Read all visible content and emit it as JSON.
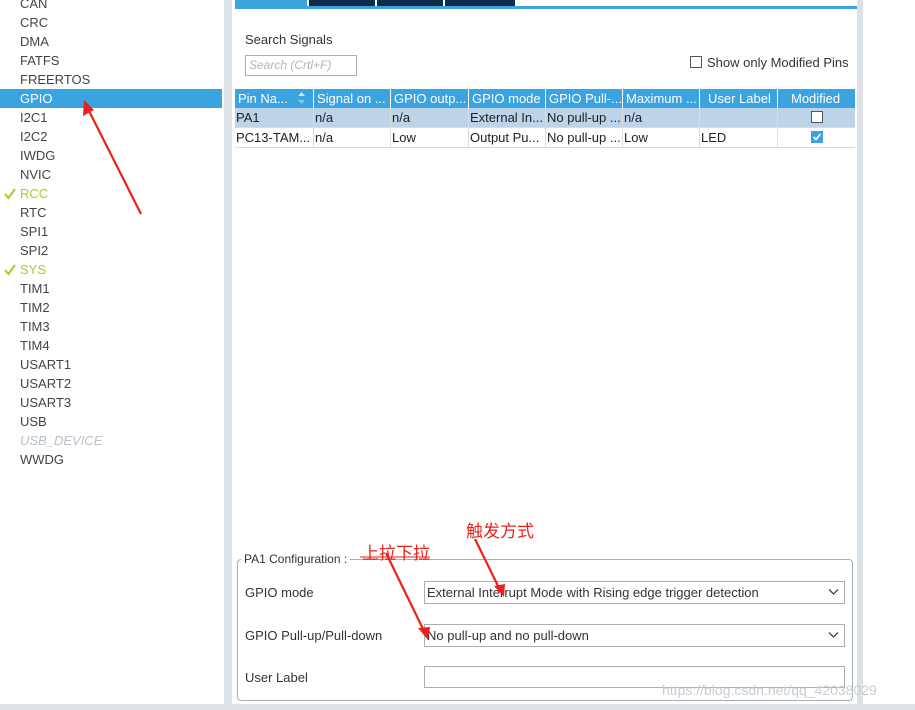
{
  "sidebar": {
    "items": [
      {
        "label": "CAN",
        "state": "normal"
      },
      {
        "label": "CRC",
        "state": "normal"
      },
      {
        "label": "DMA",
        "state": "normal"
      },
      {
        "label": "FATFS",
        "state": "normal"
      },
      {
        "label": "FREERTOS",
        "state": "normal"
      },
      {
        "label": "GPIO",
        "state": "selected"
      },
      {
        "label": "I2C1",
        "state": "normal"
      },
      {
        "label": "I2C2",
        "state": "normal"
      },
      {
        "label": "IWDG",
        "state": "normal"
      },
      {
        "label": "NVIC",
        "state": "normal"
      },
      {
        "label": "RCC",
        "state": "checked"
      },
      {
        "label": "RTC",
        "state": "normal"
      },
      {
        "label": "SPI1",
        "state": "normal"
      },
      {
        "label": "SPI2",
        "state": "normal"
      },
      {
        "label": "SYS",
        "state": "checked"
      },
      {
        "label": "TIM1",
        "state": "normal"
      },
      {
        "label": "TIM2",
        "state": "normal"
      },
      {
        "label": "TIM3",
        "state": "normal"
      },
      {
        "label": "TIM4",
        "state": "normal"
      },
      {
        "label": "USART1",
        "state": "normal"
      },
      {
        "label": "USART2",
        "state": "normal"
      },
      {
        "label": "USART3",
        "state": "normal"
      },
      {
        "label": "USB",
        "state": "normal"
      },
      {
        "label": "USB_DEVICE",
        "state": "disabled"
      },
      {
        "label": "WWDG",
        "state": "normal"
      }
    ]
  },
  "search": {
    "label": "Search Signals",
    "placeholder": "Search (Crtl+F)",
    "show_modified_label": "Show only Modified Pins",
    "show_modified_checked": false
  },
  "table": {
    "columns": [
      "Pin Na...",
      "Signal on ...",
      "GPIO outp...",
      "GPIO mode",
      "GPIO Pull-...",
      "Maximum ...",
      "User Label",
      "Modified"
    ],
    "rows": [
      {
        "cells": [
          "PA1",
          "n/a",
          "n/a",
          "External In...",
          "No pull-up ...",
          "n/a",
          ""
        ],
        "modified": false,
        "selected": true
      },
      {
        "cells": [
          "PC13-TAM...",
          "n/a",
          "Low",
          "Output Pu...",
          "No pull-up ...",
          "Low",
          "LED"
        ],
        "modified": true,
        "selected": false
      }
    ]
  },
  "config": {
    "title": "PA1 Configuration :",
    "gpio_mode_label": "GPIO mode",
    "gpio_mode_value": "External Interrupt Mode with Rising edge trigger detection",
    "pull_label": "GPIO Pull-up/Pull-down",
    "pull_value": "No pull-up and no pull-down",
    "user_label_label": "User Label",
    "user_label_value": ""
  },
  "annotations": {
    "trigger_mode": "触发方式",
    "pull_up_down": "上拉下拉",
    "color": "#e8231b"
  },
  "watermark": "https://blog.csdn.net/qq_42038029",
  "colors": {
    "accent": "#3ba3e0",
    "checked_item": "#b4c62a",
    "selected_row": "#bcd3e8",
    "tab_dark": "#0f2d4a"
  }
}
